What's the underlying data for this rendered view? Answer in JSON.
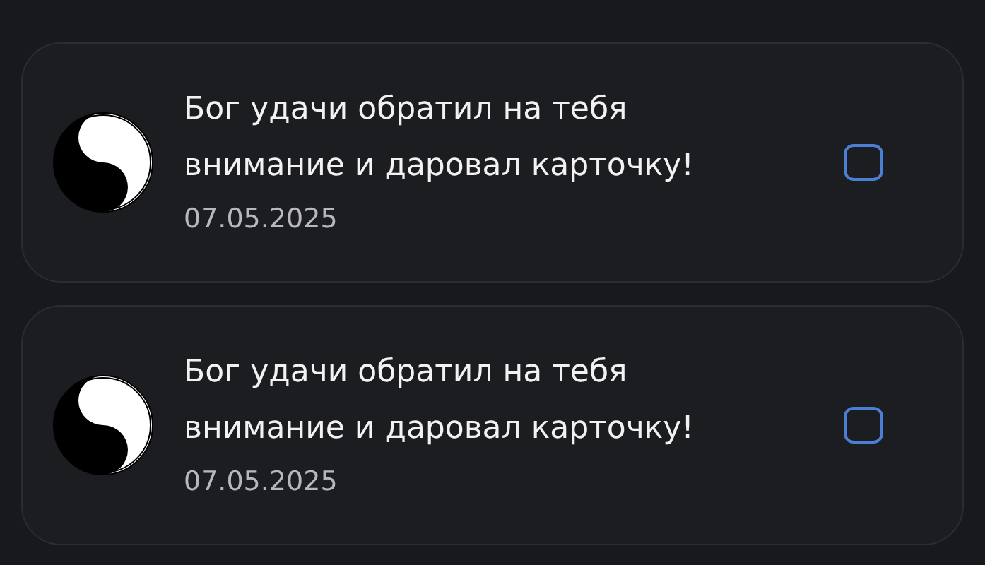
{
  "notifications": [
    {
      "message": "Бог удачи обратил на тебя внимание и даровал карточку!",
      "date": "07.05.2025",
      "checked": false
    },
    {
      "message": "Бог удачи обратил на тебя внимание и даровал карточку!",
      "date": "07.05.2025",
      "checked": false
    }
  ]
}
